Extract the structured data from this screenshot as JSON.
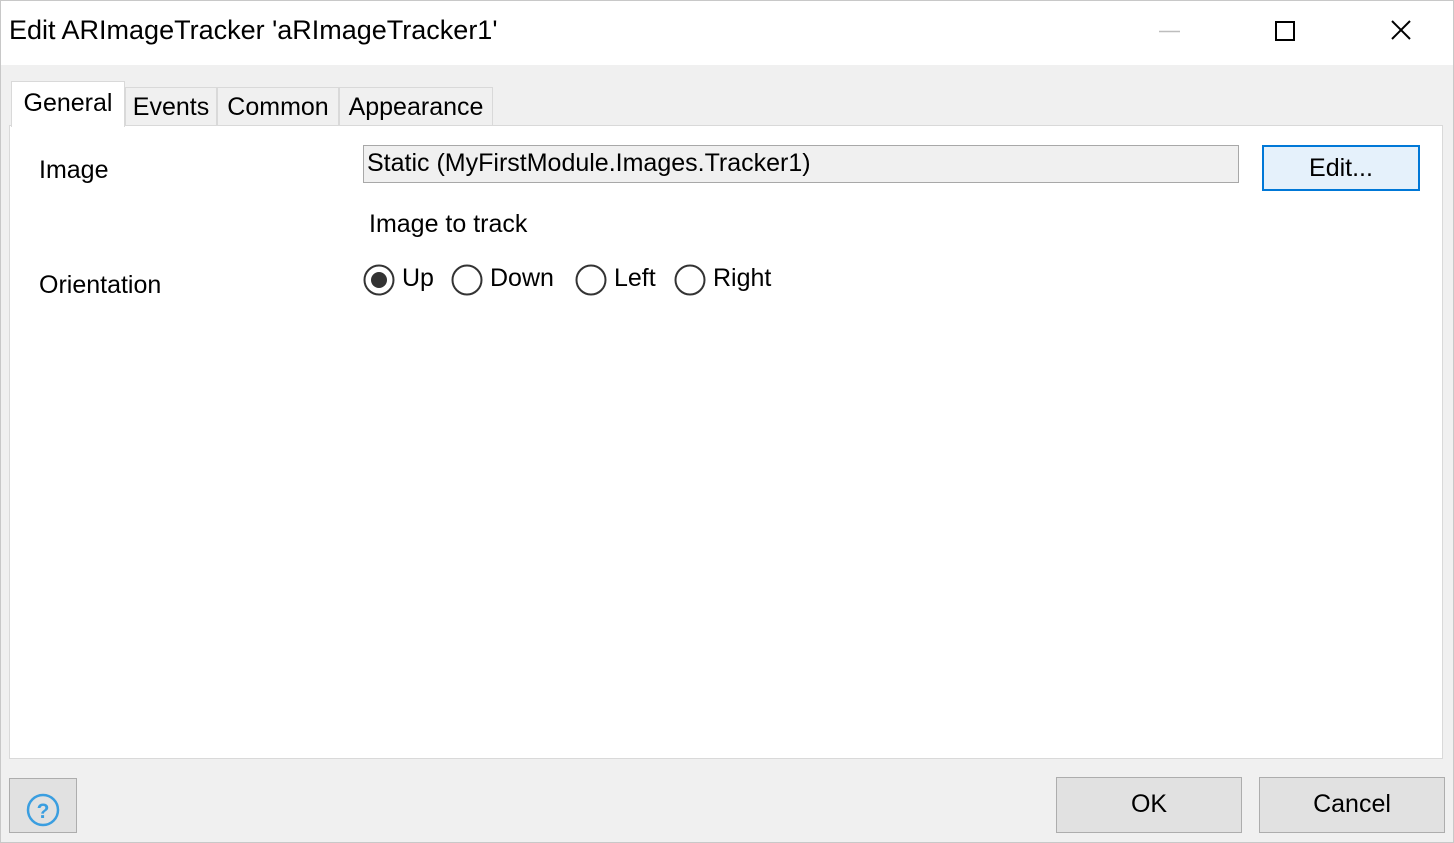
{
  "window": {
    "title": "Edit ARImageTracker 'aRImageTracker1'"
  },
  "tabs": [
    {
      "label": "General",
      "active": true
    },
    {
      "label": "Events",
      "active": false
    },
    {
      "label": "Common",
      "active": false
    },
    {
      "label": "Appearance",
      "active": false
    }
  ],
  "general": {
    "image_label": "Image",
    "image_value": "Static (MyFirstModule.Images.Tracker1)",
    "edit_button": "Edit...",
    "image_hint": "Image to track",
    "orientation_label": "Orientation",
    "orientation_options": [
      {
        "label": "Up",
        "selected": true
      },
      {
        "label": "Down",
        "selected": false
      },
      {
        "label": "Left",
        "selected": false
      },
      {
        "label": "Right",
        "selected": false
      }
    ]
  },
  "footer": {
    "ok_label": "OK",
    "cancel_label": "Cancel",
    "help_icon": "help-icon"
  },
  "colors": {
    "accent": "#0078d7",
    "help_icon": "#3a9ee0"
  }
}
